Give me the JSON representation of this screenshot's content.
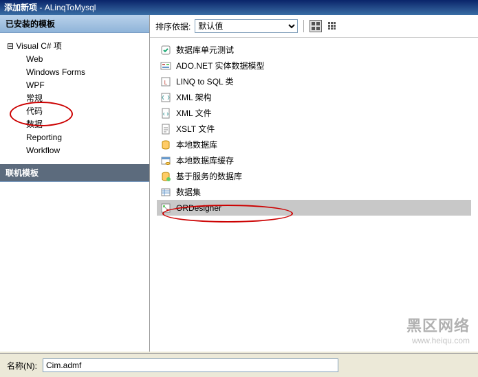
{
  "window": {
    "title": "添加新项",
    "project": "ALinqToMysql"
  },
  "sidebar": {
    "installed_header": "已安装的模板",
    "online_header": "联机模板",
    "tree": {
      "root": "Visual C# 项",
      "children": [
        "Web",
        "Windows Forms",
        "WPF",
        "常规",
        "代码",
        "数据",
        "Reporting",
        "Workflow"
      ]
    }
  },
  "toolbar": {
    "sort_label": "排序依据:",
    "sort_value": "默认值"
  },
  "items": [
    {
      "label": "数据库单元测试",
      "icon": "db-test"
    },
    {
      "label": "ADO.NET 实体数据模型",
      "icon": "ado-model"
    },
    {
      "label": "LINQ to SQL 类",
      "icon": "linq-sql"
    },
    {
      "label": "XML 架构",
      "icon": "xml-schema"
    },
    {
      "label": "XML 文件",
      "icon": "xml-file"
    },
    {
      "label": "XSLT 文件",
      "icon": "xslt-file"
    },
    {
      "label": "本地数据库",
      "icon": "local-db"
    },
    {
      "label": "本地数据库缓存",
      "icon": "db-cache"
    },
    {
      "label": "基于服务的数据库",
      "icon": "service-db"
    },
    {
      "label": "数据集",
      "icon": "dataset"
    },
    {
      "label": "ORDesigner",
      "icon": "ordesigner",
      "selected": true
    }
  ],
  "name_field": {
    "label": "名称(N):",
    "value": "Cim.admf"
  },
  "watermark": {
    "line1": "黑区网络",
    "line2": "www.heiqu.com"
  }
}
